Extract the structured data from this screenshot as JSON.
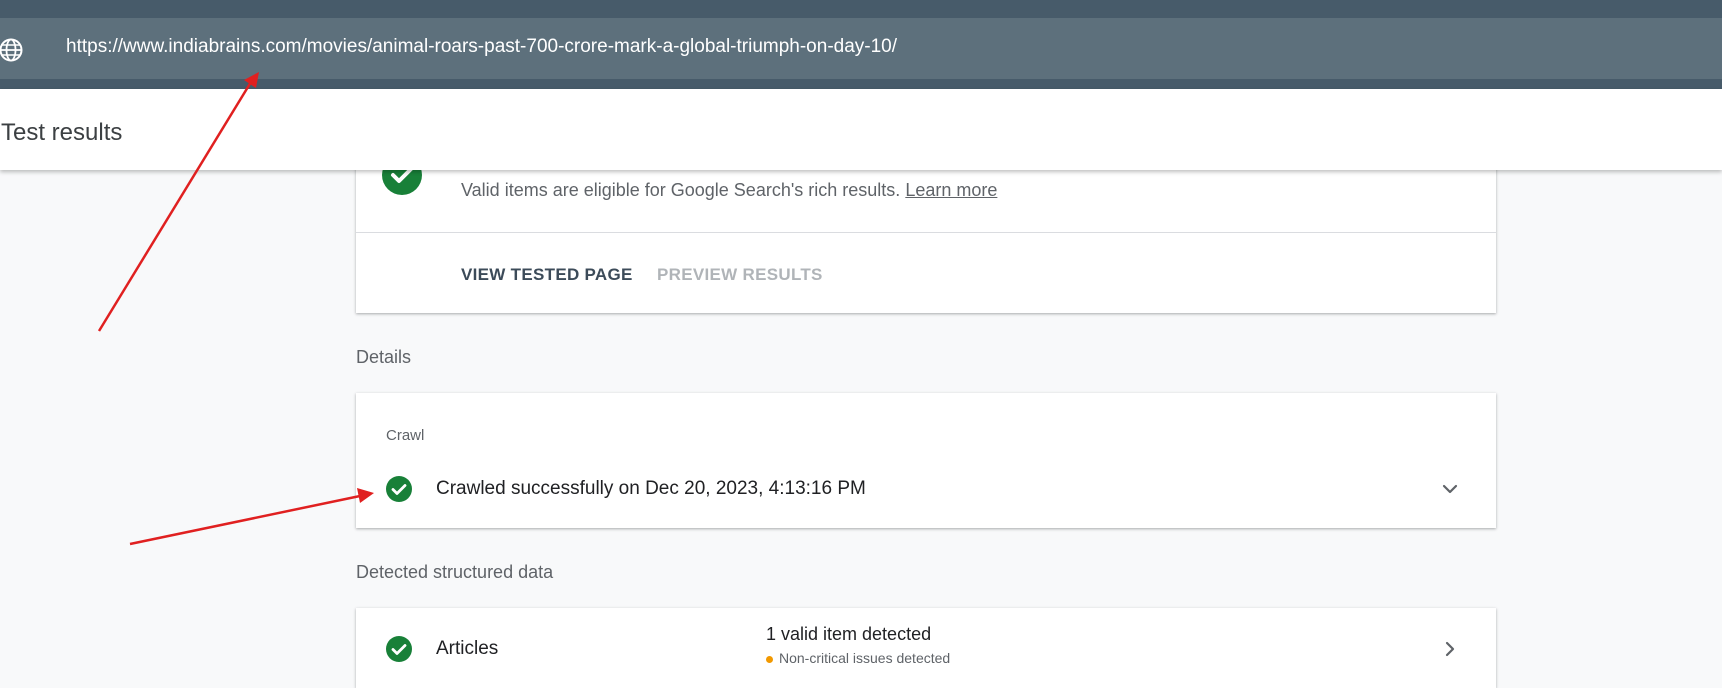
{
  "url_bar": {
    "url": "https://www.indiabrains.com/movies/animal-roars-past-700-crore-mark-a-global-triumph-on-day-10/",
    "icon": "globe-icon"
  },
  "header": {
    "title": "Test results"
  },
  "summary_card": {
    "description": "Valid items are eligible for Google Search's rich results.",
    "learn_more": "Learn more",
    "view_tested_page": "VIEW TESTED PAGE",
    "preview_results": "PREVIEW RESULTS"
  },
  "details": {
    "section_label": "Details",
    "crawl_label": "Crawl",
    "crawl_status": "Crawled successfully on Dec 20, 2023, 4:13:16 PM"
  },
  "structured_data": {
    "section_label": "Detected structured data",
    "items": [
      {
        "name": "Articles",
        "valid_text": "1 valid item detected",
        "issue_text": "Non-critical issues detected"
      }
    ]
  },
  "colors": {
    "success": "#188038",
    "warning": "#f29900",
    "annotation": "#e02020",
    "url_bar_bg": "#5d707c"
  }
}
